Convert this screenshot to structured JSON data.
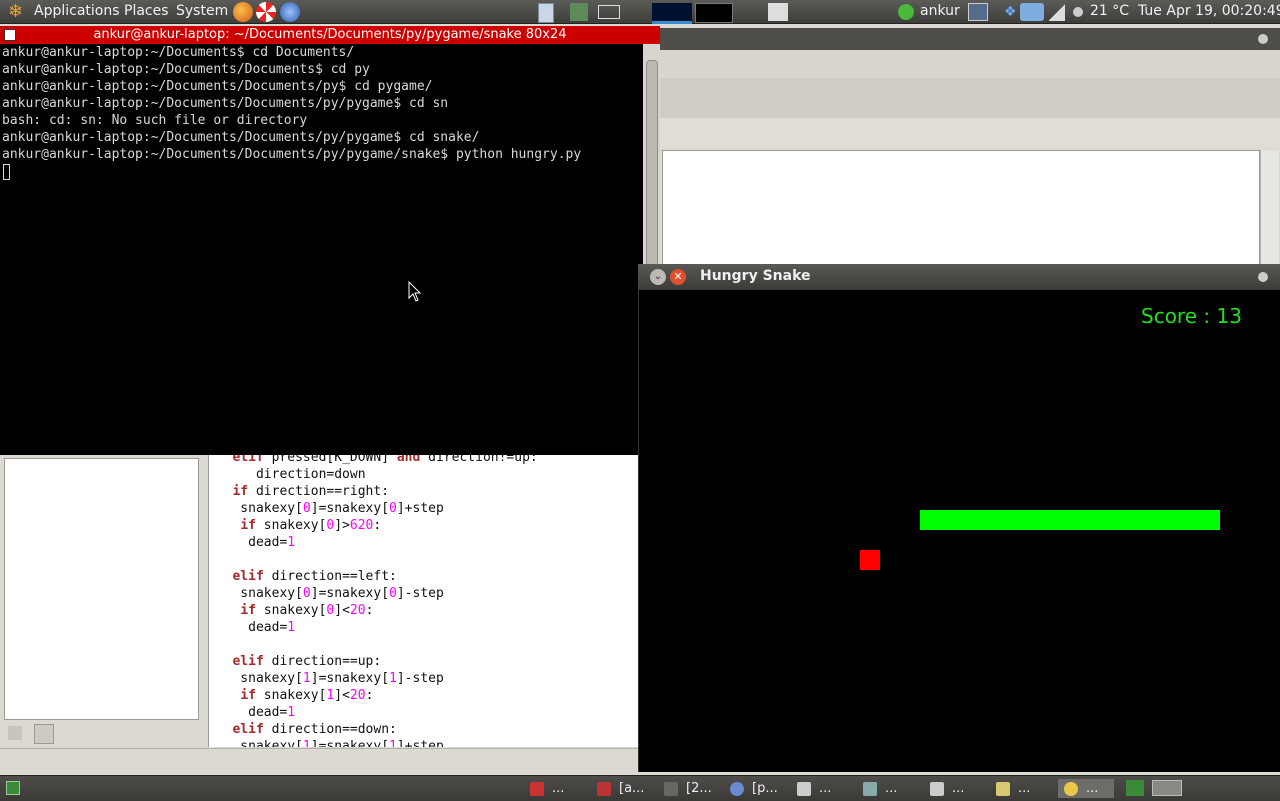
{
  "top_panel": {
    "menus": [
      "Applications",
      "Places",
      "System"
    ],
    "user": "ankur",
    "temperature": "21 °C",
    "clock": "Tue Apr 19, 00:20:49"
  },
  "terminal": {
    "title": "ankur@ankur-laptop: ~/Documents/Documents/py/pygame/snake 80x24",
    "lines": [
      "ankur@ankur-laptop:~/Documents$ cd Documents/",
      "ankur@ankur-laptop:~/Documents/Documents$ cd py",
      "ankur@ankur-laptop:~/Documents/Documents/py$ cd pygame/",
      "ankur@ankur-laptop:~/Documents/Documents/py/pygame$ cd sn",
      "bash: cd: sn: No such file or directory",
      "ankur@ankur-laptop:~/Documents/Documents/py/pygame$ cd snake/",
      "ankur@ankur-laptop:~/Documents/Documents/py/pygame/snake$ python hungry.py"
    ]
  },
  "game_window": {
    "title": "Hungry Snake",
    "score": "Score : 13"
  },
  "taskbar": {
    "items": [
      "...",
      "[a...",
      "[2...",
      "[p...",
      "...",
      "...",
      "...",
      "...",
      "..."
    ]
  },
  "colors": {
    "terminal_title_bg": "#cc0000",
    "snake": "#00ff00",
    "food": "#ff0000",
    "score": "#20e020"
  }
}
